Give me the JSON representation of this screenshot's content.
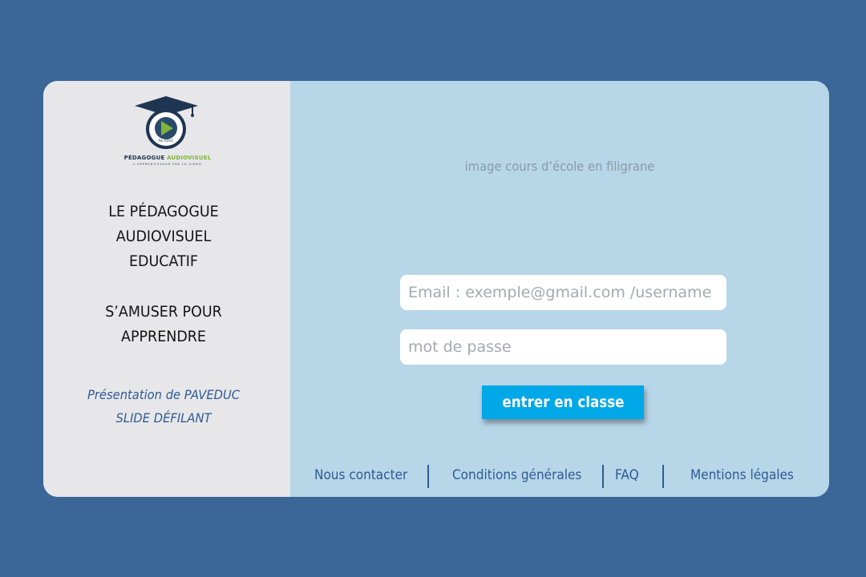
{
  "logo": {
    "name_part1": "PÉDAGOGUE ",
    "name_part2": "AUDIOVISUEL",
    "tagline": "L'APPRENTISSAGE PAR LA VIDEO",
    "badge": "Par EDUC"
  },
  "sidebar": {
    "headline_1": [
      "LE PÉDAGOGUE",
      "AUDIOVISUEL",
      "EDUCATIF"
    ],
    "headline_2": [
      "S’AMUSER POUR",
      "APPRENDRE"
    ],
    "presentation": [
      "Présentation de PAVEDUC",
      "SLIDE DÉFILANT"
    ]
  },
  "main": {
    "watermark_text": "image cours d’école en filigrane",
    "email_placeholder": "Email : exemple@gmail.com /username",
    "password_placeholder": "mot de passe",
    "submit_label": "entrer en classe"
  },
  "footer": {
    "links": [
      "Nous contacter",
      "Conditions générales",
      "FAQ",
      "Mentions légales"
    ]
  },
  "colors": {
    "page_background": "#3a6698",
    "sidebar_background": "#e7e7e9",
    "main_background": "#b7d6e8",
    "button": "#00a8e8",
    "link": "#2e5b93",
    "logo_play": "#7fb43a"
  }
}
